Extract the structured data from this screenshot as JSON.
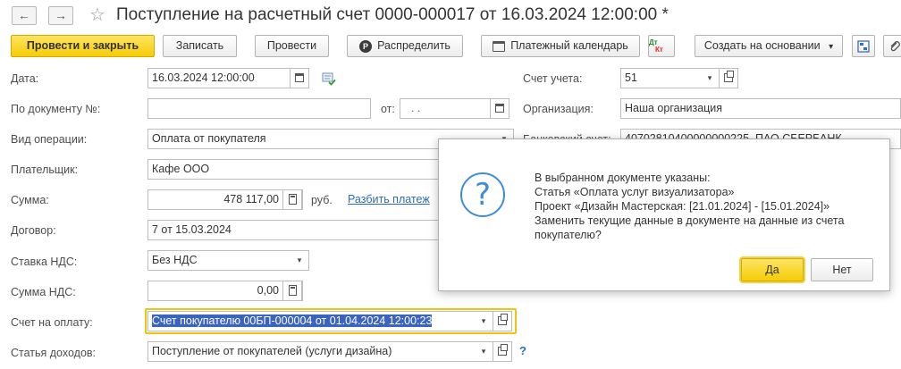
{
  "title_bar": {
    "back_glyph": "←",
    "forward_glyph": "→",
    "star_glyph": "☆",
    "title": "Поступление на расчетный счет 0000-000017 от 16.03.2024 12:00:00 *"
  },
  "toolbar": {
    "post_close": "Провести и закрыть",
    "save": "Записать",
    "post": "Провести",
    "distribute": "Распределить",
    "distribute_icon": "P",
    "payment_calendar": "Платежный календарь",
    "dt_label": "Дт",
    "kt_label": "Кт",
    "create_based": "Создать на основании",
    "dropdown_glyph": "▾",
    "accent_color": "#f5cd06"
  },
  "form": {
    "date_label": "Дата:",
    "date_value": "16.03.2024 12:00:00",
    "doc_no_label": "По документу №:",
    "doc_no_value": "",
    "from_label": "от:",
    "from_value": ". .",
    "operation_label": "Вид операции:",
    "operation_value": "Оплата от покупателя",
    "payer_label": "Плательщик:",
    "payer_value": "Кафе ООО",
    "sum_label": "Сумма:",
    "sum_value": "478 117,00",
    "currency": "руб.",
    "split_link": "Разбить платеж",
    "contract_label": "Договор:",
    "contract_value": "7 от 15.03.2024",
    "vat_rate_label": "Ставка НДС:",
    "vat_rate_value": "Без НДС",
    "vat_sum_label": "Сумма НДС:",
    "vat_sum_value": "0,00",
    "invoice_label": "Счет на оплату:",
    "invoice_value": "Счет покупателю 00БП-000004 от 01.04.2024 12:00:23",
    "income_label": "Статья доходов:",
    "income_value": "Поступление от покупателей (услуги дизайна)",
    "help_glyph": "?",
    "account_label": "Счет учета:",
    "account_value": "51",
    "org_label": "Организация:",
    "org_value": "Наша организация",
    "bank_label": "Банковский счет:",
    "bank_value": "40702810400000000225, ПАО СБЕРБАНК"
  },
  "dialog": {
    "icon_glyph": "?",
    "line1": "В выбранном документе указаны:",
    "line2": "Статья «Оплата услуг визуализатора»",
    "line3": "Проект «Дизайн Мастерская: [21.01.2024] - [15.01.2024]»",
    "line4": "Заменить текущие данные в документе на данные из счета",
    "line5": "покупателю?",
    "yes": "Да",
    "no": "Нет"
  }
}
